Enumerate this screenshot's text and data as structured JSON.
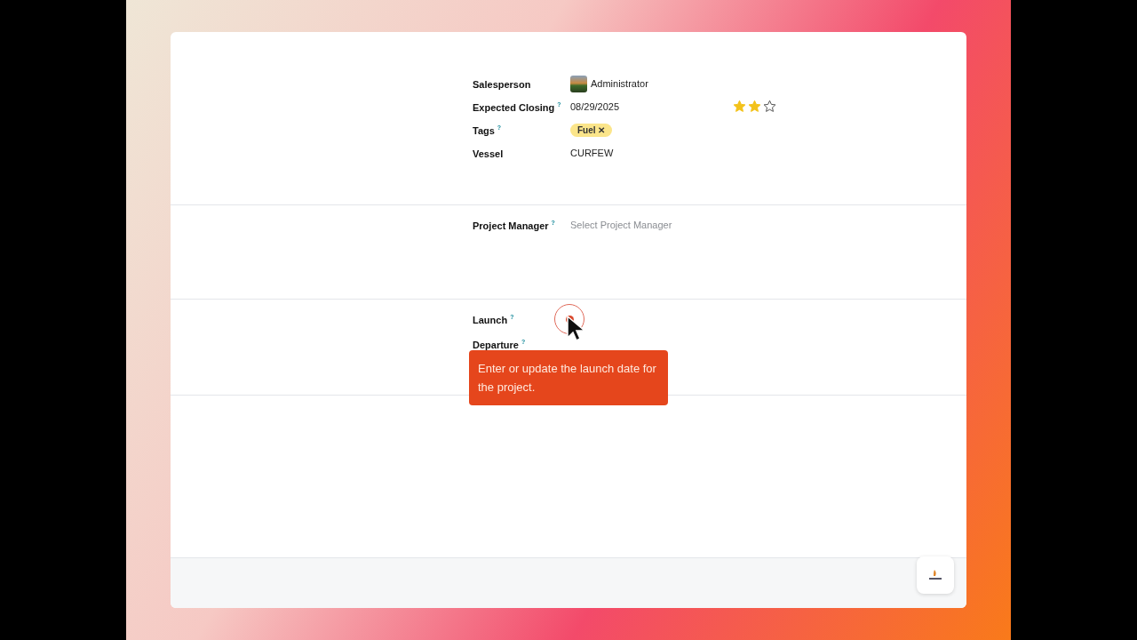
{
  "sections": [
    {
      "fields": [
        {
          "kind": "user",
          "label": "Salesperson",
          "value": "Administrator"
        },
        {
          "kind": "text",
          "label": "Expected Closing",
          "help": "?",
          "value": "08/29/2025",
          "priority": {
            "stars": 2
          }
        },
        {
          "kind": "tags",
          "label": "Tags",
          "help": "?",
          "tags": [
            {
              "label": "Fuel",
              "remove": "✕"
            }
          ]
        },
        {
          "kind": "text",
          "label": "Vessel",
          "value": "CURFEW"
        }
      ]
    },
    {
      "fields": [
        {
          "kind": "select",
          "label": "Project Manager",
          "help": "?",
          "placeholder": "Select Project Manager"
        }
      ]
    },
    {
      "fields": [
        {
          "kind": "highlight",
          "label": "Launch",
          "help": "?"
        },
        {
          "kind": "empty",
          "label": "Departure",
          "help": "?"
        }
      ]
    }
  ],
  "tooltip": {
    "text": "Enter or update the launch date for the project."
  }
}
